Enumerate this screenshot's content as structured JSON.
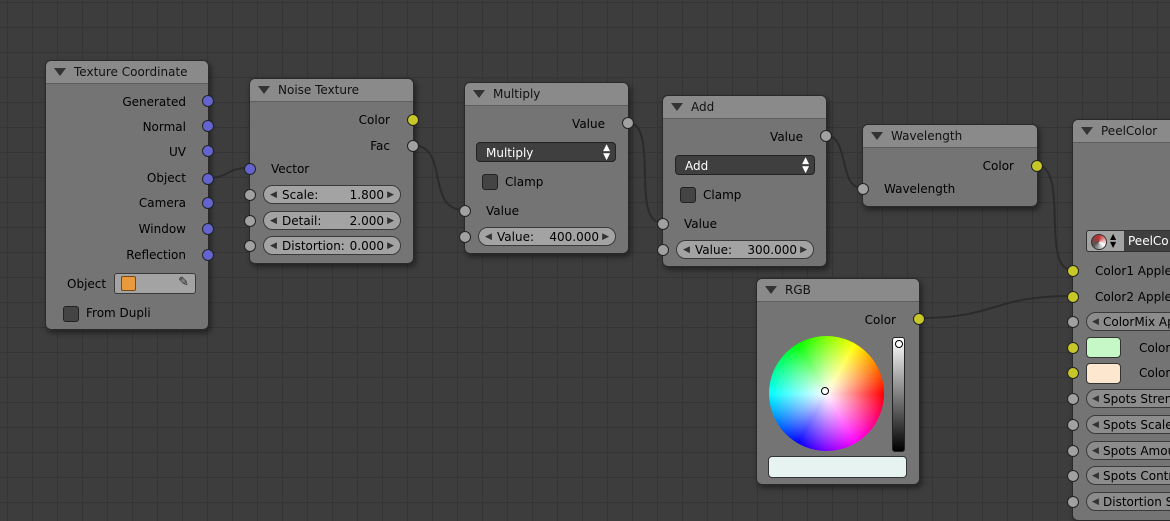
{
  "texture_coordinate": {
    "title": "Texture Coordinate",
    "outputs": [
      "Generated",
      "Normal",
      "UV",
      "Object",
      "Camera",
      "Window",
      "Reflection"
    ],
    "object_label": "Object",
    "from_dupli_label": "From Dupli"
  },
  "noise_texture": {
    "title": "Noise Texture",
    "out_color": "Color",
    "out_fac": "Fac",
    "in_vector": "Vector",
    "scale_label": "Scale:",
    "scale_value": "1.800",
    "detail_label": "Detail:",
    "detail_value": "2.000",
    "distortion_label": "Distortion:",
    "distortion_value": "0.000"
  },
  "multiply": {
    "title": "Multiply",
    "out_value": "Value",
    "operation": "Multiply",
    "clamp_label": "Clamp",
    "in_value": "Value",
    "value_label": "Value:",
    "value_value": "400.000"
  },
  "add": {
    "title": "Add",
    "out_value": "Value",
    "operation": "Add",
    "clamp_label": "Clamp",
    "in_value": "Value",
    "value_label": "Value:",
    "value_value": "300.000"
  },
  "wavelength": {
    "title": "Wavelength",
    "out_color": "Color",
    "in_wavelength": "Wavelength"
  },
  "rgb": {
    "title": "RGB",
    "out_color": "Color",
    "swatch_color": "#e6f3f0"
  },
  "peelcolor": {
    "title": "PeelColor",
    "group_name": "PeelCo",
    "inputs": {
      "color1": "Color1 Apple",
      "color2": "Color2 Apple",
      "colormix": "ColorMix Ap",
      "color_a": "Color",
      "color_b": "Color",
      "spots_strength": "Spots Streng",
      "spots_scale": "Spots Scale:",
      "spots_amount": "Spots Amou",
      "spots_contrast": "Spots Contra",
      "distortion": "Distortion S"
    },
    "color_a_swatch": "#c6f7c6",
    "color_b_swatch": "#fde8cf"
  },
  "colors": {
    "vector_socket": "#6464ce",
    "color_socket": "#c7c729",
    "value_socket": "#a1a1a1",
    "wire": "#2b2b2b"
  }
}
